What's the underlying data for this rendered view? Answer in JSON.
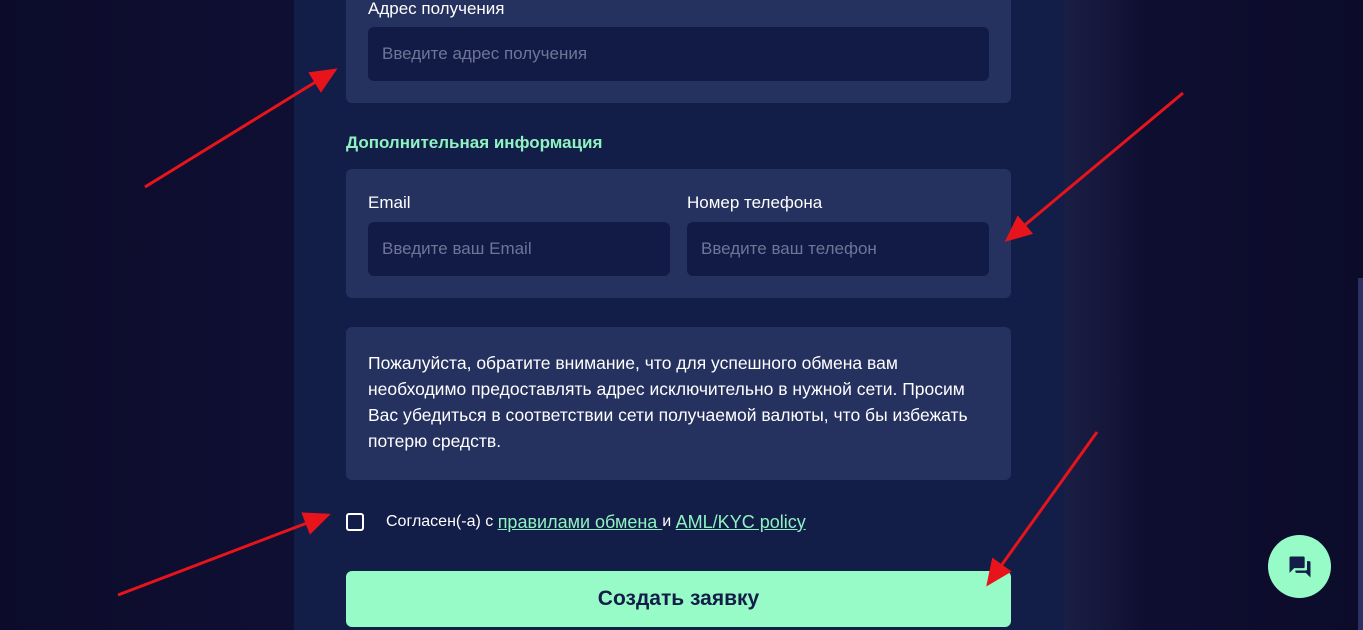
{
  "address_section": {
    "label": "Адрес получения",
    "placeholder": "Введите адрес получения"
  },
  "additional_info": {
    "title": "Дополнительная информация",
    "email_label": "Email",
    "email_placeholder": "Введите ваш Email",
    "phone_label": "Номер телефона",
    "phone_placeholder": "Введите ваш телефон"
  },
  "notice": {
    "text": "Пожалуйста, обратите внимание, что для успешного обмена вам необходимо предоставлять адрес исключительно в нужной сети. Просим Вас убедиться в соответствии сети получаемой валюты, что бы избежать потерю средств."
  },
  "agreement": {
    "prefix": "Согласен(-а) с ",
    "rules_link": "правилами обмена ",
    "conjunction": "и ",
    "policy_link": "AML/KYC policy",
    "checked": false
  },
  "submit_label": "Создать заявку",
  "chat_icon": "chat-bubbles-icon",
  "colors": {
    "accent": "#97fbc7",
    "section_title": "#8ff2c1",
    "card_bg": "#25315f",
    "input_bg": "#121b45",
    "column_bg": "#121d48",
    "annotation_arrow": "#e8141b"
  }
}
